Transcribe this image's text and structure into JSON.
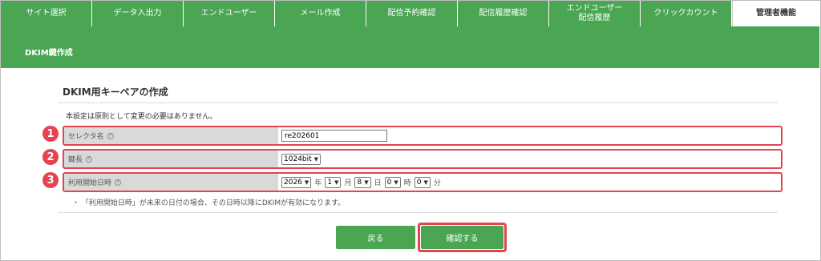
{
  "nav": {
    "tabs": [
      {
        "label": "サイト選択",
        "active": false
      },
      {
        "label": "データ入出力",
        "active": false
      },
      {
        "label": "エンドユーザー",
        "active": false
      },
      {
        "label": "メール作成",
        "active": false
      },
      {
        "label": "配信予約確認",
        "active": false
      },
      {
        "label": "配信履歴確認",
        "active": false
      },
      {
        "label": "エンドユーザー\n配信履歴",
        "active": false
      },
      {
        "label": "クリックカウント",
        "active": false
      },
      {
        "label": "管理者機能",
        "active": true
      }
    ]
  },
  "subheader": {
    "title": "DKIM鍵作成"
  },
  "main": {
    "title": "DKIM用キーペアの作成",
    "note": "本設定は原則として変更の必要はありません。",
    "badges": [
      "1",
      "2",
      "3"
    ],
    "help_symbol": "?",
    "selector": {
      "label": "セレクタ名",
      "value": "re202601"
    },
    "key_length": {
      "label": "鍵長",
      "value": "1024bit"
    },
    "start_date": {
      "label": "利用開始日時",
      "year": "2026",
      "year_unit": "年",
      "month": "1",
      "month_unit": "月",
      "day": "8",
      "day_unit": "日",
      "hour": "0",
      "hour_unit": "時",
      "minute": "0",
      "minute_unit": "分"
    },
    "bullet_note": "・ 「利用開始日時」が未来の日付の場合、その日時以降にDKIMが有効になります。"
  },
  "buttons": {
    "back": "戻る",
    "confirm": "確認する"
  },
  "colors": {
    "accent": "#4aa653",
    "highlight": "#e5434f"
  }
}
